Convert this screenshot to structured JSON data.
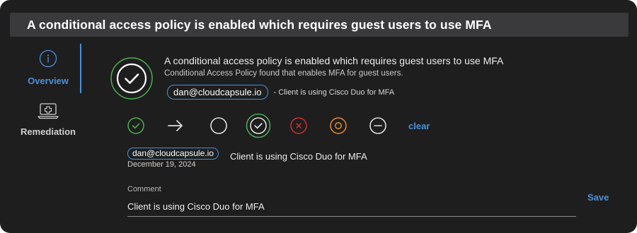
{
  "window": {
    "title": "A conditional access policy is enabled which requires guest users to use MFA"
  },
  "sidebar": {
    "items": [
      {
        "label": "Overview",
        "icon": "info-icon",
        "active": true
      },
      {
        "label": "Remediation",
        "icon": "laptop-medical-icon",
        "active": false
      }
    ]
  },
  "header": {
    "status_icon": "check-circle-icon",
    "title": "A conditional access policy is enabled which requires guest users to use MFA",
    "subtitle": "Conditional Access Policy found that enables MFA for guest users.",
    "user_chip": "dan@cloudcapsule.io",
    "note": "- Client is using Cisco Duo for MFA"
  },
  "status_options": {
    "icons": [
      "check-circle-icon",
      "arrow-right-icon",
      "empty-circle-icon",
      "check-circle-selected-icon",
      "x-circle-icon",
      "target-circle-icon",
      "minus-circle-icon"
    ],
    "clear_label": "clear"
  },
  "entry": {
    "user": "dan@cloudcapsule.io",
    "date": "December 19, 2024",
    "text": "Client is using Cisco Duo for MFA"
  },
  "comment": {
    "label": "Comment",
    "value": "Client is using Cisco Duo for MFA",
    "save_label": "Save"
  },
  "colors": {
    "accent": "#4a90d9",
    "success": "#4caf50",
    "danger": "#d32f2f",
    "warning": "#e68a2e",
    "background": "#1e1e1f",
    "title_bar": "#3a3a3c"
  }
}
